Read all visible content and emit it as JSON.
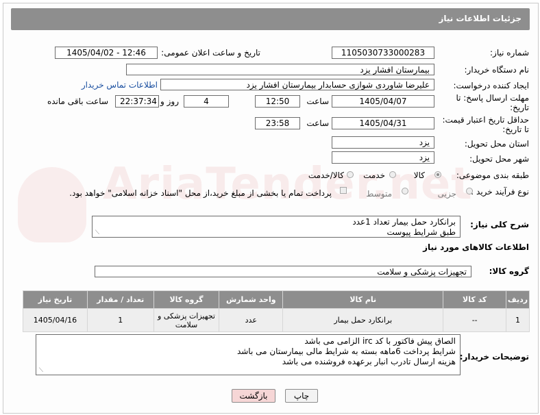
{
  "header": {
    "title": "جزئیات اطلاعات نیاز"
  },
  "form": {
    "need_number_label": "شماره نیاز:",
    "need_number": "1105030733000283",
    "announce_label": "تاریخ و ساعت اعلان عمومی:",
    "announce_value": "1405/04/02 - 12:46",
    "buyer_org_label": "نام دستگاه خریدار:",
    "buyer_org": "بیمارستان افشار یزد",
    "requester_label": "ایجاد کننده درخواست:",
    "requester": "علیرضا شاوردی شوازی حسابدار بیمارستان افشار یزد",
    "contact_link": "اطلاعات تماس خریدار",
    "deadline_label_1": "مهلت ارسال پاسخ: تا",
    "deadline_label_2": "تاریخ:",
    "deadline_date": "1405/04/07",
    "time_label": "ساعت",
    "deadline_time": "12:50",
    "days_value": "4",
    "days_label": "روز و",
    "remaining_value": "22:37:34",
    "remaining_label": "ساعت باقی مانده",
    "price_validity_label_1": "حداقل تاریخ اعتبار قیمت:",
    "price_validity_label_2": "تا تاریخ:",
    "price_validity_date": "1405/04/31",
    "price_validity_time": "23:58",
    "province_label": "استان محل تحویل:",
    "province": "یزد",
    "city_label": "شهر محل تحویل:",
    "city": "یزد",
    "category_label": "طبقه بندی موضوعی:",
    "category_options": [
      "کالا",
      "خدمت",
      "کالا/خدمت"
    ],
    "purchase_type_label": "نوع فرآیند خرید :",
    "purchase_options": [
      "جزیی",
      "متوسط"
    ],
    "payment_note": "پرداخت تمام یا بخشی از مبلغ خرید،از محل \"اسناد خزانه اسلامی\" خواهد بود.",
    "description_label": "شرح کلی نیاز:",
    "description_lines": [
      "برانکارد حمل بیمار تعداد 1عدد",
      "طبق شرایط پیوست"
    ],
    "goods_info_title": "اطلاعات کالاهای مورد نیاز",
    "goods_group_label": "گروه کالا:",
    "goods_group": "تجهیزات پزشکی و سلامت"
  },
  "table": {
    "headers": [
      "ردیف",
      "کد کالا",
      "نام کالا",
      "واحد شمارش",
      "گروه کالا",
      "تعداد / مقدار",
      "تاریخ نیاز"
    ],
    "rows": [
      [
        "1",
        "--",
        "برانکارد حمل بیمار",
        "عدد",
        "تجهیزات پزشکی و سلامت",
        "1",
        "1405/04/16"
      ]
    ]
  },
  "buyer_notes": {
    "label": "توضیحات خریدار:",
    "lines": [
      "الصاق پیش فاکتور  با کد irc الزامی می باشد",
      "شرایط پرداخت 6ماهه بسته به شرایط مالی بیمارستان می باشد",
      "هزینه ارسال تادرب انبار برعهده فروشنده می باشد"
    ]
  },
  "buttons": {
    "print": "چاپ",
    "back": "بازگشت"
  },
  "watermark": "AriaTender.net",
  "colors": {
    "header_bg": "#8e8e8e",
    "link": "#1a4fa0",
    "back_btn": "#f6d6d6",
    "print_btn": "#f3f3f3"
  }
}
